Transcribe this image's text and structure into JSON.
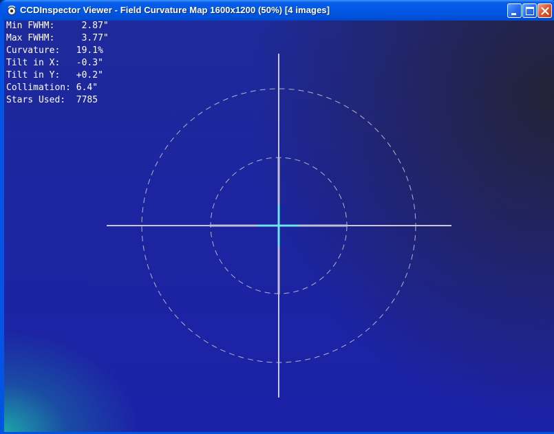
{
  "window": {
    "title": "CCDInspector Viewer - Field Curvature Map 1600x1200 (50%)  [4 images]",
    "app_icon": "ccdinspector-app-icon",
    "controls": [
      "minimize-icon",
      "maximize-icon",
      "close-icon"
    ]
  },
  "stats": [
    {
      "label": "Min FWHM:",
      "value": "2.87\""
    },
    {
      "label": "Max FWHM:",
      "value": "3.77\""
    },
    {
      "label": "Curvature:",
      "value": "19.1%"
    },
    {
      "label": "Tilt in X:",
      "value": "-0.3\""
    },
    {
      "label": "Tilt in Y:",
      "value": "+0.2\""
    },
    {
      "label": "Collimation:",
      "value": "6.4\""
    },
    {
      "label": "Stars Used:",
      "value": "7785"
    }
  ],
  "colors": {
    "title_bar": "#0058e6",
    "map_background": "#1c24a0",
    "map_corner_teal": "#1eaaaa",
    "map_corner_dark": "#232337",
    "crosshair": "#c8c8d8",
    "rings": "#b4b4c8",
    "center_marker": "#6ee6f0",
    "text": "#ffffff"
  }
}
